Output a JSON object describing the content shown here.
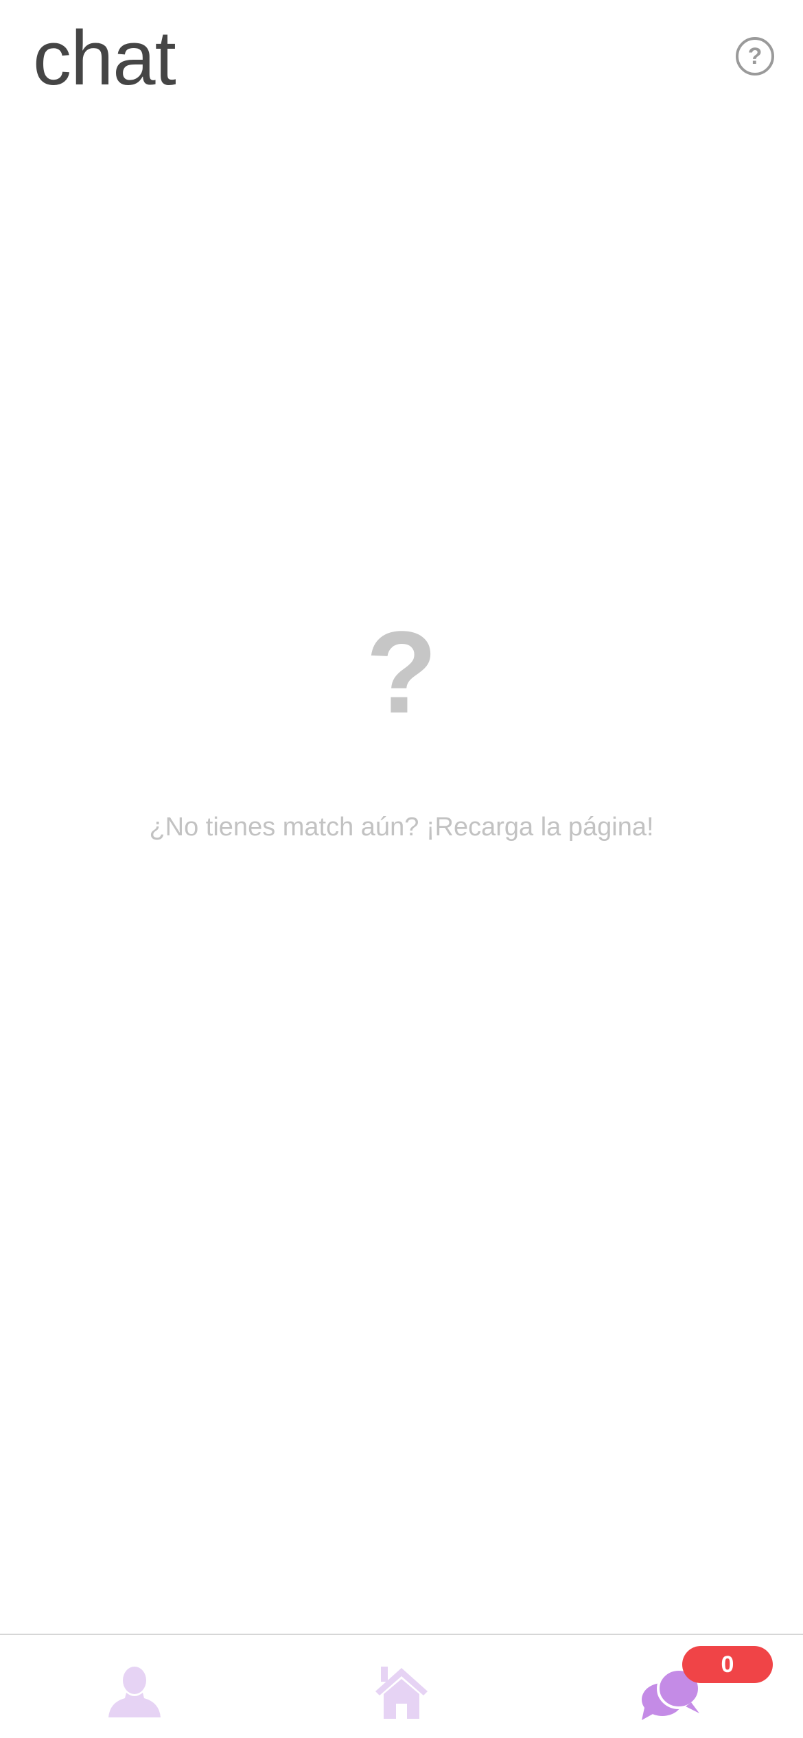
{
  "header": {
    "title": "chat",
    "help_label": "?"
  },
  "empty_state": {
    "icon_glyph": "?",
    "message": "¿No tienes match aún? ¡Recarga la página!"
  },
  "bottom_nav": {
    "items": [
      {
        "icon": "profile-icon",
        "color": "#e6d3f4",
        "active": false
      },
      {
        "icon": "home-icon",
        "color": "#e6d3f4",
        "active": false
      },
      {
        "icon": "chat-bubbles-icon",
        "color": "#c48be6",
        "active": true
      }
    ],
    "chat_badge_count": "0",
    "badge_color": "#f04447"
  }
}
